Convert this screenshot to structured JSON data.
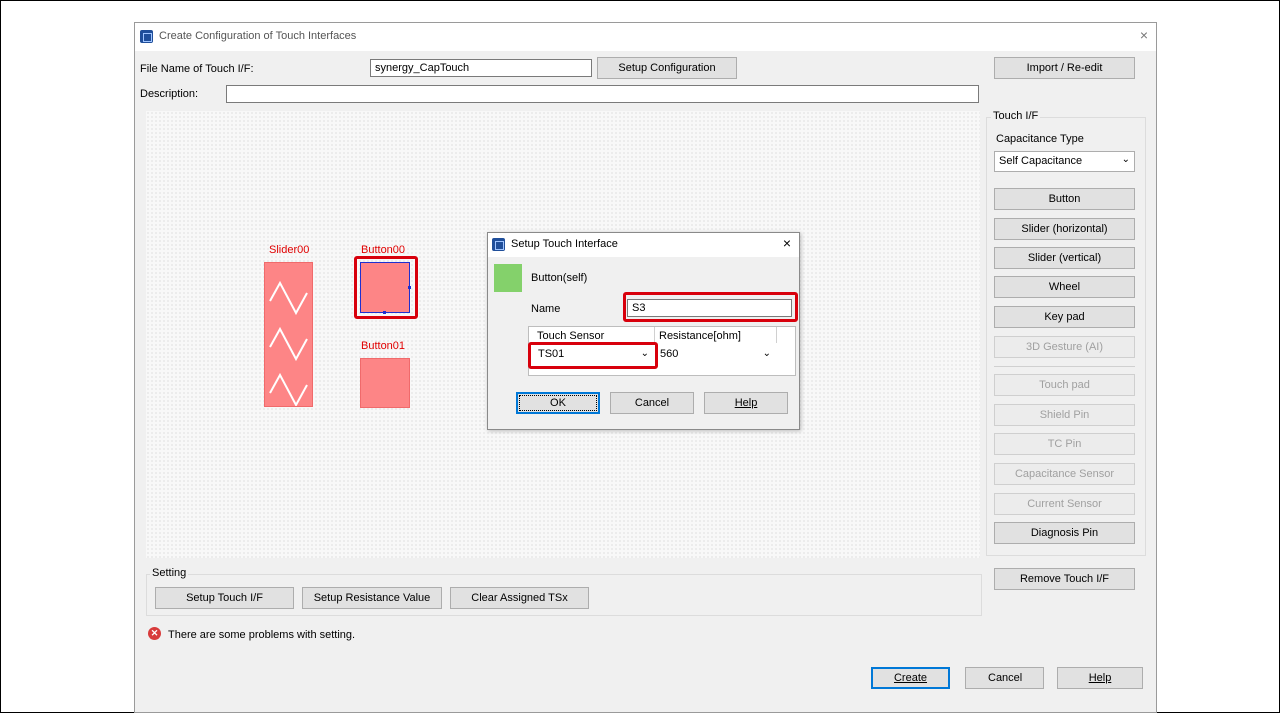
{
  "window": {
    "title": "Create Configuration of Touch Interfaces",
    "close": "×"
  },
  "form": {
    "file_name_label": "File Name of Touch I/F:",
    "file_name_value": "synergy_CapTouch",
    "setup_config_button": "Setup Configuration",
    "description_label": "Description:",
    "description_value": "",
    "import_button": "Import / Re-edit"
  },
  "canvas": {
    "slider_label": "Slider00",
    "button00_label": "Button00",
    "button01_label": "Button01"
  },
  "touch_if": {
    "group_label": "Touch I/F",
    "cap_type_label": "Capacitance Type",
    "cap_type_value": "Self Capacitance",
    "buttons": [
      {
        "label": "Button",
        "enabled": true
      },
      {
        "label": "Slider (horizontal)",
        "enabled": true
      },
      {
        "label": "Slider (vertical)",
        "enabled": true
      },
      {
        "label": "Wheel",
        "enabled": true
      },
      {
        "label": "Key pad",
        "enabled": true
      },
      {
        "label": "3D Gesture (AI)",
        "enabled": false
      },
      {
        "label": "Touch pad",
        "enabled": false
      },
      {
        "label": "Shield Pin",
        "enabled": false
      },
      {
        "label": "TC Pin",
        "enabled": false
      },
      {
        "label": "Capacitance Sensor",
        "enabled": false
      },
      {
        "label": "Current Sensor",
        "enabled": false
      },
      {
        "label": "Diagnosis Pin",
        "enabled": true
      }
    ],
    "remove_button": "Remove Touch I/F"
  },
  "setting": {
    "group_label": "Setting",
    "setup_touch_button": "Setup Touch I/F",
    "setup_resistance_button": "Setup Resistance Value",
    "clear_tsx_button": "Clear Assigned TSx"
  },
  "status": {
    "message": "There are some problems with setting.",
    "icon": "error-icon"
  },
  "footer": {
    "create": "Create",
    "cancel": "Cancel",
    "help": "Help"
  },
  "dialog": {
    "title": "Setup Touch Interface",
    "close": "×",
    "type_label": "Button(self)",
    "name_label": "Name",
    "name_value": "S3",
    "col_sensor": "Touch Sensor",
    "col_resistance": "Resistance[ohm]",
    "sensor_value": "TS01",
    "resistance_value": "560",
    "ok": "OK",
    "cancel": "Cancel",
    "help": "Help"
  },
  "colors": {
    "element_fill": "#fd8586",
    "element_label": "#e00000",
    "highlight": "#d8000c",
    "type_swatch": "#84d16b"
  }
}
